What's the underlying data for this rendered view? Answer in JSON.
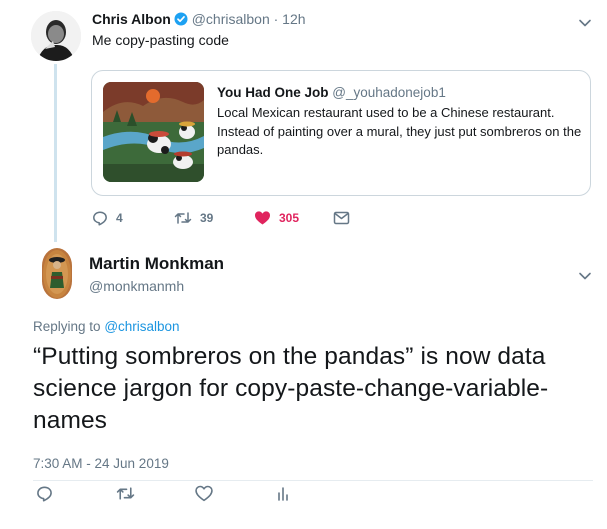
{
  "parent_tweet": {
    "author_name": "Chris Albon",
    "author_handle": "@chrisalbon",
    "time": "· 12h",
    "text": "Me copy-pasting code",
    "quoted": {
      "author_name": "You Had One Job",
      "author_handle": "@_youhadonejob1",
      "text": "Local Mexican restaurant used to be a Chinese restaurant. Instead of painting over a mural, they just put sombreros on the pandas."
    },
    "actions": {
      "replies": "4",
      "retweets": "39",
      "likes": "305"
    }
  },
  "main_tweet": {
    "author_name": "Martin Monkman",
    "author_handle": "@monkmanmh",
    "replying_prefix": "Replying to",
    "replying_to": "@chrisalbon",
    "text": "“Putting sombreros on the pandas” is now data science jargon for copy-paste-change-variable-names",
    "timestamp": "7:30 AM - 24 Jun 2019"
  },
  "colors": {
    "like": "#e0245e",
    "link": "#1b95e0",
    "verified": "#1da1f2",
    "muted": "#657786",
    "thread_line": "#cfe3ee"
  },
  "icons": [
    "verified-icon",
    "chevron-down-icon",
    "reply-icon",
    "retweet-icon",
    "heart-icon",
    "direct-message-icon",
    "analytics-icon"
  ]
}
